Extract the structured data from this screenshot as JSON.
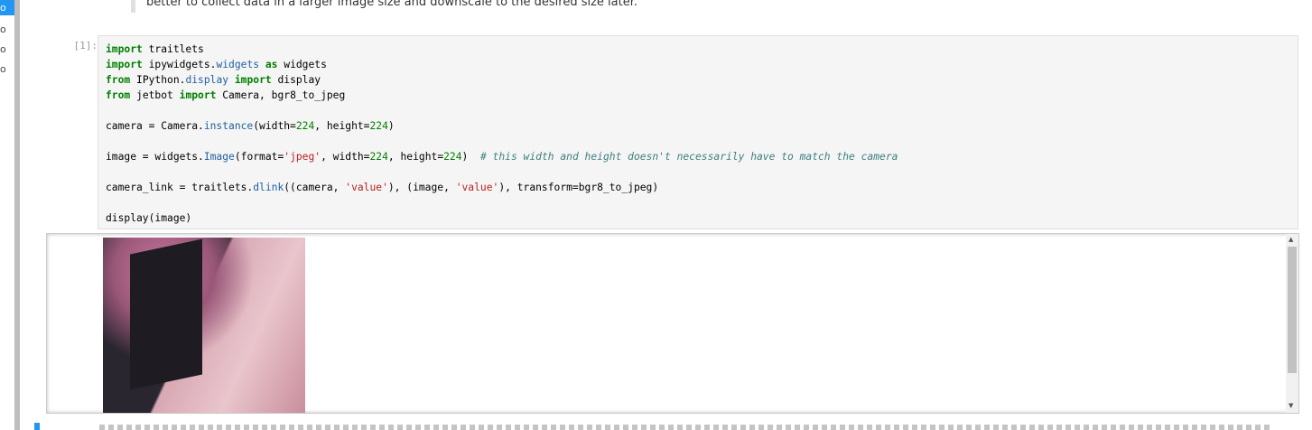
{
  "markdown_text": "better to collect data in a larger image size and downscale to the desired size later.",
  "cell": {
    "prompt": "[1]:",
    "lines": [
      [
        [
          "k",
          "import"
        ],
        [
          "t",
          " traitlets"
        ]
      ],
      [
        [
          "k",
          "import"
        ],
        [
          "t",
          " ipywidgets."
        ],
        [
          "a",
          "widgets"
        ],
        [
          "t",
          " "
        ],
        [
          "k",
          "as"
        ],
        [
          "t",
          " widgets"
        ]
      ],
      [
        [
          "k",
          "from"
        ],
        [
          "t",
          " IPython."
        ],
        [
          "a",
          "display"
        ],
        [
          "t",
          " "
        ],
        [
          "k",
          "import"
        ],
        [
          "t",
          " display"
        ]
      ],
      [
        [
          "k",
          "from"
        ],
        [
          "t",
          " jetbot "
        ],
        [
          "k",
          "import"
        ],
        [
          "t",
          " Camera, bgr8_to_jpeg"
        ]
      ],
      [],
      [
        [
          "t",
          "camera = Camera."
        ],
        [
          "a",
          "instance"
        ],
        [
          "t",
          "(width="
        ],
        [
          "n",
          "224"
        ],
        [
          "t",
          ", height="
        ],
        [
          "n",
          "224"
        ],
        [
          "t",
          ")"
        ]
      ],
      [],
      [
        [
          "t",
          "image = widgets."
        ],
        [
          "a",
          "Image"
        ],
        [
          "t",
          "(format="
        ],
        [
          "s",
          "'jpeg'"
        ],
        [
          "t",
          ", width="
        ],
        [
          "n",
          "224"
        ],
        [
          "t",
          ", height="
        ],
        [
          "n",
          "224"
        ],
        [
          "t",
          ")  "
        ],
        [
          "c",
          "# this width and height doesn't necessarily have to match the camera"
        ]
      ],
      [],
      [
        [
          "t",
          "camera_link = traitlets."
        ],
        [
          "a",
          "dlink"
        ],
        [
          "t",
          "((camera, "
        ],
        [
          "s",
          "'value'"
        ],
        [
          "t",
          "), (image, "
        ],
        [
          "s",
          "'value'"
        ],
        [
          "t",
          "), transform=bgr8_to_jpeg)"
        ]
      ],
      [],
      [
        [
          "t",
          "display(image)"
        ]
      ]
    ]
  },
  "sidebar_icons": [
    "o",
    "o",
    "o",
    "o"
  ]
}
